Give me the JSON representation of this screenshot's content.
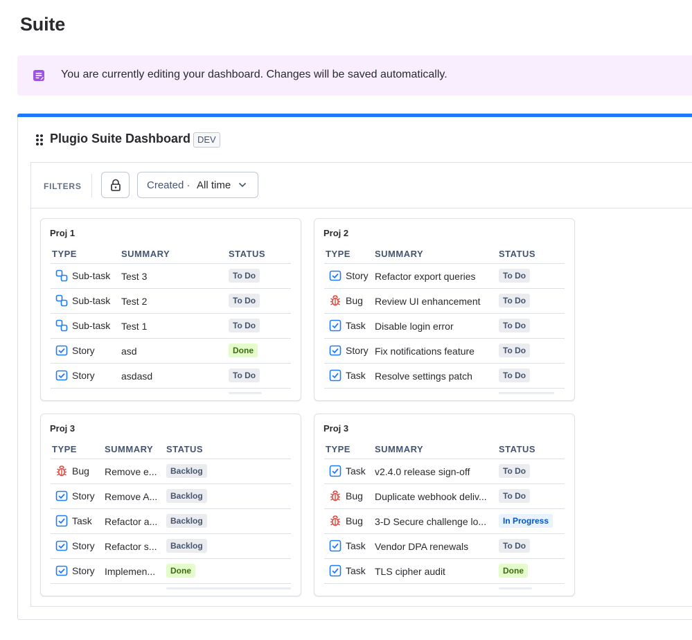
{
  "page": {
    "title": "Suite"
  },
  "banner": {
    "text": "You are currently editing your dashboard. Changes will be saved automatically.",
    "icon": "edit-page-icon",
    "bg_color": "#f8eefe",
    "icon_color": "#9f53e3"
  },
  "dashboard": {
    "title": "Plugio Suite Dashboard",
    "env_badge": "DEV",
    "accent_color": "#1d7afc"
  },
  "filters": {
    "label": "FILTERS",
    "lock_icon": "lock-icon",
    "date_key": "Created ·",
    "date_value": "All time"
  },
  "gadgets": [
    {
      "title": "Proj 1",
      "columns": [
        "TYPE",
        "SUMMARY",
        "STATUS"
      ],
      "rows": [
        {
          "type": "Sub-task",
          "icon": "subtask-icon",
          "summary": "Test 3",
          "status": "To Do",
          "tone": "gray"
        },
        {
          "type": "Sub-task",
          "icon": "subtask-icon",
          "summary": "Test 2",
          "status": "To Do",
          "tone": "gray"
        },
        {
          "type": "Sub-task",
          "icon": "subtask-icon",
          "summary": "Test 1",
          "status": "To Do",
          "tone": "gray"
        },
        {
          "type": "Story",
          "icon": "story-icon",
          "summary": "asd",
          "status": "Done",
          "tone": "green"
        },
        {
          "type": "Story",
          "icon": "story-icon",
          "summary": "asdasd",
          "status": "To Do",
          "tone": "gray"
        }
      ]
    },
    {
      "title": "Proj 2",
      "columns": [
        "TYPE",
        "SUMMARY",
        "STATUS"
      ],
      "rows": [
        {
          "type": "Story",
          "icon": "story-icon",
          "summary": "Refactor export queries",
          "status": "To Do",
          "tone": "gray"
        },
        {
          "type": "Bug",
          "icon": "bug-icon",
          "summary": "Review UI enhancement",
          "status": "To Do",
          "tone": "gray"
        },
        {
          "type": "Task",
          "icon": "task-icon",
          "summary": "Disable login error",
          "status": "To Do",
          "tone": "gray"
        },
        {
          "type": "Story",
          "icon": "story-icon",
          "summary": "Fix notifications feature",
          "status": "To Do",
          "tone": "gray"
        },
        {
          "type": "Task",
          "icon": "task-icon",
          "summary": "Resolve settings patch",
          "status": "To Do",
          "tone": "gray"
        }
      ]
    },
    {
      "title": "Proj 3",
      "columns": [
        "TYPE",
        "SUMMARY",
        "STATUS"
      ],
      "rows": [
        {
          "type": "Bug",
          "icon": "bug-icon",
          "summary": "Remove e...",
          "status": "Backlog",
          "tone": "gray"
        },
        {
          "type": "Story",
          "icon": "story-icon",
          "summary": "Remove A...",
          "status": "Backlog",
          "tone": "gray"
        },
        {
          "type": "Task",
          "icon": "task-icon",
          "summary": "Refactor a...",
          "status": "Backlog",
          "tone": "gray"
        },
        {
          "type": "Story",
          "icon": "story-icon",
          "summary": "Refactor s...",
          "status": "Backlog",
          "tone": "gray"
        },
        {
          "type": "Story",
          "icon": "story-icon",
          "summary": "Implemen...",
          "status": "Done",
          "tone": "green"
        }
      ]
    },
    {
      "title": "Proj 3",
      "columns": [
        "TYPE",
        "SUMMARY",
        "STATUS"
      ],
      "rows": [
        {
          "type": "Task",
          "icon": "task-icon",
          "summary": "v2.4.0 release sign-off",
          "status": "To Do",
          "tone": "gray"
        },
        {
          "type": "Bug",
          "icon": "bug-icon",
          "summary": "Duplicate webhook deliv...",
          "status": "To Do",
          "tone": "gray"
        },
        {
          "type": "Bug",
          "icon": "bug-icon",
          "summary": "3-D Secure challenge lo...",
          "status": "In Progress",
          "tone": "blue"
        },
        {
          "type": "Task",
          "icon": "task-icon",
          "summary": "Vendor DPA renewals",
          "status": "To Do",
          "tone": "gray"
        },
        {
          "type": "Task",
          "icon": "task-icon",
          "summary": "TLS cipher audit",
          "status": "Done",
          "tone": "green"
        }
      ]
    }
  ],
  "colors": {
    "task_blue": "#1d7afc",
    "bug_red": "#e2483d",
    "story_blue": "#1d7afc"
  }
}
